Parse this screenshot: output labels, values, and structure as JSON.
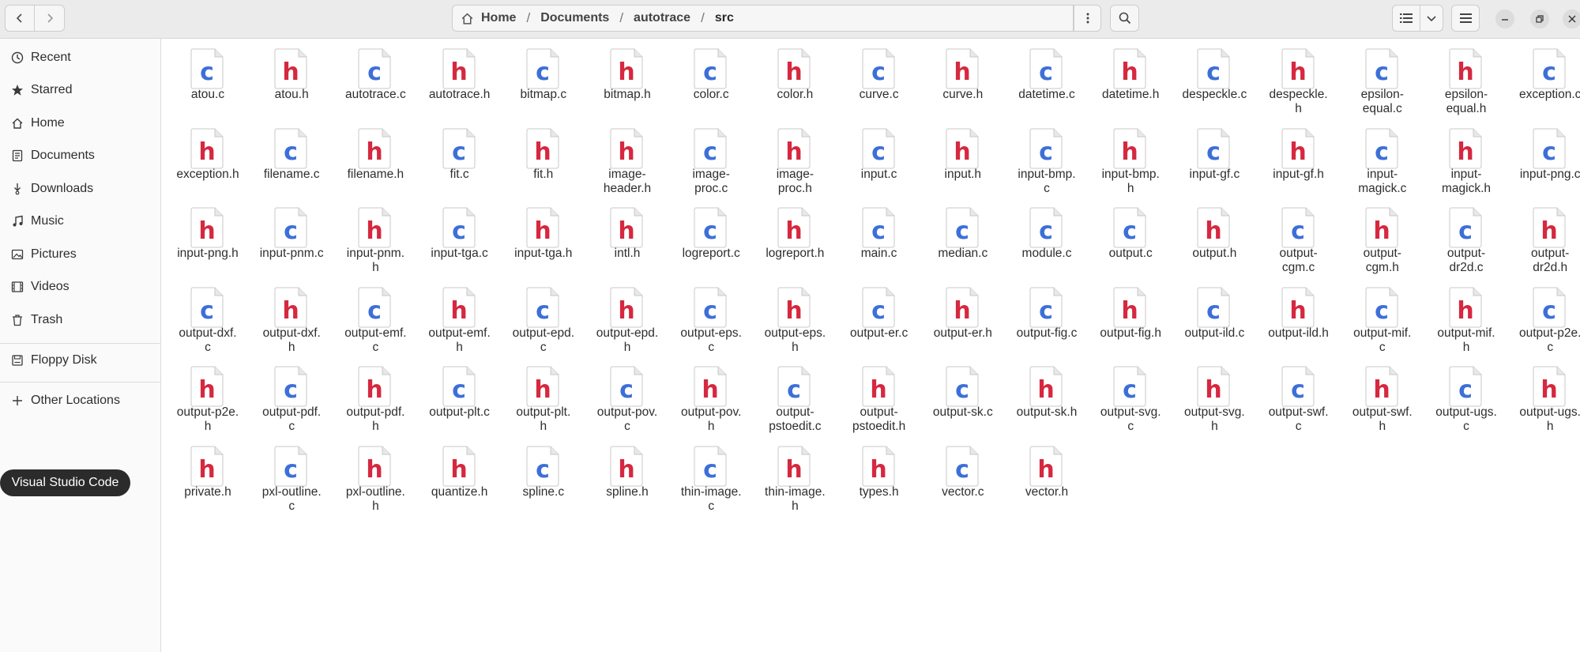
{
  "header": {
    "breadcrumbs": [
      {
        "label": "Home"
      },
      {
        "label": "Documents"
      },
      {
        "label": "autotrace"
      },
      {
        "label": "src"
      }
    ]
  },
  "sidebar": {
    "items": [
      {
        "label": "Recent",
        "icon": "clock-icon"
      },
      {
        "label": "Starred",
        "icon": "star-icon"
      },
      {
        "label": "Home",
        "icon": "home-icon"
      },
      {
        "label": "Documents",
        "icon": "document-icon"
      },
      {
        "label": "Downloads",
        "icon": "download-icon"
      },
      {
        "label": "Music",
        "icon": "music-icon"
      },
      {
        "label": "Pictures",
        "icon": "picture-icon"
      },
      {
        "label": "Videos",
        "icon": "video-icon"
      },
      {
        "label": "Trash",
        "icon": "trash-icon"
      }
    ],
    "devices": [
      {
        "label": "Floppy Disk",
        "icon": "floppy-disk-icon"
      }
    ],
    "other": {
      "label": "Other Locations",
      "icon": "plus-icon"
    },
    "tooltip": "Visual Studio Code"
  },
  "colors": {
    "c_file": "#3d6fd8",
    "h_file": "#d6283f"
  },
  "files": [
    [
      "atou.c",
      "atou.h",
      "autotrace.c",
      "autotrace.h",
      "bitmap.c",
      "bitmap.h",
      "color.c",
      "color.h",
      "curve.c",
      "curve.h",
      "datetime.c",
      "datetime.h",
      "despeckle.c",
      "despeckle.h",
      "epsilon-equal.c",
      "epsilon-equal.h",
      "exception.c"
    ],
    [
      "exception.h",
      "filename.c",
      "filename.h",
      "fit.c",
      "fit.h",
      "image-header.h",
      "image-proc.c",
      "image-proc.h",
      "input.c",
      "input.h",
      "input-bmp.c",
      "input-bmp.h",
      "input-gf.c",
      "input-gf.h",
      "input-magick.c",
      "input-magick.h",
      "input-png.c"
    ],
    [
      "input-png.h",
      "input-pnm.c",
      "input-pnm.h",
      "input-tga.c",
      "input-tga.h",
      "intl.h",
      "logreport.c",
      "logreport.h",
      "main.c",
      "median.c",
      "module.c",
      "output.c",
      "output.h",
      "output-cgm.c",
      "output-cgm.h",
      "output-dr2d.c",
      "output-dr2d.h"
    ],
    [
      "output-dxf.c",
      "output-dxf.h",
      "output-emf.c",
      "output-emf.h",
      "output-epd.c",
      "output-epd.h",
      "output-eps.c",
      "output-eps.h",
      "output-er.c",
      "output-er.h",
      "output-fig.c",
      "output-fig.h",
      "output-ild.c",
      "output-ild.h",
      "output-mif.c",
      "output-mif.h",
      "output-p2e.c"
    ],
    [
      "output-p2e.h",
      "output-pdf.c",
      "output-pdf.h",
      "output-plt.c",
      "output-plt.h",
      "output-pov.c",
      "output-pov.h",
      "output-pstoedit.c",
      "output-pstoedit.h",
      "output-sk.c",
      "output-sk.h",
      "output-svg.c",
      "output-svg.h",
      "output-swf.c",
      "output-swf.h",
      "output-ugs.c",
      "output-ugs.h"
    ],
    [
      "private.h",
      "pxl-outline.c",
      "pxl-outline.h",
      "quantize.h",
      "spline.c",
      "spline.h",
      "thin-image.c",
      "thin-image.h",
      "types.h",
      "vector.c",
      "vector.h"
    ]
  ],
  "display_names": {
    "despeckle.h": "despeckle.\nh",
    "epsilon-equal.c": "epsilon-\nequal.c",
    "epsilon-equal.h": "epsilon-\nequal.h",
    "image-header.h": "image-\nheader.h",
    "image-proc.c": "image-\nproc.c",
    "image-proc.h": "image-\nproc.h",
    "input-bmp.c": "input-bmp.\nc",
    "input-bmp.h": "input-bmp.\nh",
    "input-magick.c": "input-\nmagick.c",
    "input-magick.h": "input-\nmagick.h",
    "input-pnm.h": "input-pnm.\nh",
    "output-cgm.c": "output-\ncgm.c",
    "output-cgm.h": "output-\ncgm.h",
    "output-dr2d.c": "output-\ndr2d.c",
    "output-dr2d.h": "output-\ndr2d.h",
    "output-dxf.c": "output-dxf.\nc",
    "output-dxf.h": "output-dxf.\nh",
    "output-emf.c": "output-emf.\nc",
    "output-emf.h": "output-emf.\nh",
    "output-epd.c": "output-epd.\nc",
    "output-epd.h": "output-epd.\nh",
    "output-eps.c": "output-eps.\nc",
    "output-eps.h": "output-eps.\nh",
    "output-mif.c": "output-mif.\nc",
    "output-mif.h": "output-mif.\nh",
    "output-p2e.c": "output-p2e.\nc",
    "output-p2e.h": "output-p2e.\nh",
    "output-pdf.c": "output-pdf.\nc",
    "output-pdf.h": "output-pdf.\nh",
    "output-plt.h": "output-plt.\nh",
    "output-pov.c": "output-pov.\nc",
    "output-pov.h": "output-pov.\nh",
    "output-pstoedit.c": "output-\npstoedit.c",
    "output-pstoedit.h": "output-\npstoedit.h",
    "output-svg.c": "output-svg.\nc",
    "output-svg.h": "output-svg.\nh",
    "output-swf.c": "output-swf.\nc",
    "output-swf.h": "output-swf.\nh",
    "output-ugs.c": "output-ugs.\nc",
    "output-ugs.h": "output-ugs.\nh",
    "pxl-outline.c": "pxl-outline.\nc",
    "pxl-outline.h": "pxl-outline.\nh",
    "thin-image.c": "thin-image.\nc",
    "thin-image.h": "thin-image.\nh"
  }
}
